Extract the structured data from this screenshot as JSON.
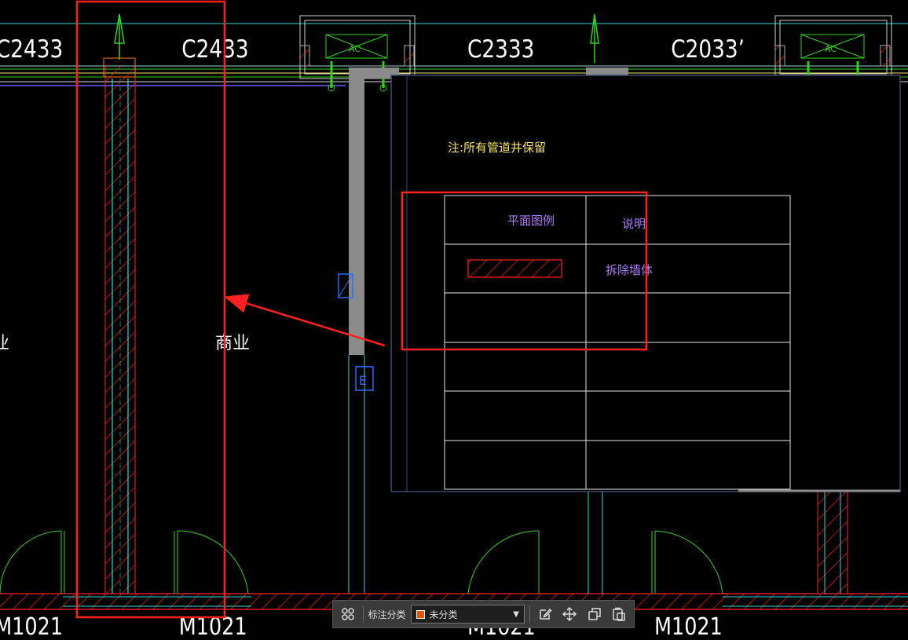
{
  "drawing": {
    "window_labels": [
      "C2433",
      "C2433",
      "C2333",
      "C2033’"
    ],
    "door_labels": [
      "M1021",
      "M1021",
      "M1021",
      "M1021"
    ],
    "room_labels": [
      "商业",
      "业"
    ],
    "ac_label": "AC",
    "note": "注:所有管道井保留",
    "legend": {
      "header_left": "平面图例",
      "header_right": "说明",
      "row1_desc": "拆除墙体"
    },
    "equipment_letter": "E"
  },
  "toolbar": {
    "category_label": "标注分类",
    "category_value": "未分类",
    "category_color": "#e8540a"
  },
  "colors": {
    "highlight": "#ff2020",
    "cyan": "#2fd6d6",
    "green": "#34d020",
    "legend_text": "#b07cff",
    "note_text": "#f5e663"
  }
}
